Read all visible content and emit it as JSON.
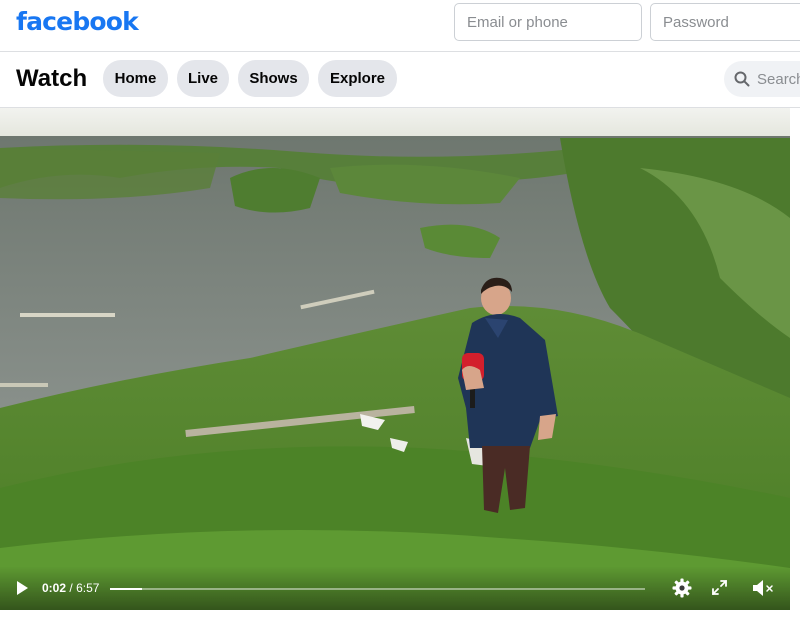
{
  "header": {
    "logo_text": "facebook",
    "logo_color": "#1877f2",
    "email_placeholder": "Email or phone",
    "password_placeholder": "Password"
  },
  "watch": {
    "title": "Watch",
    "tabs": [
      {
        "label": "Home"
      },
      {
        "label": "Live"
      },
      {
        "label": "Shows"
      },
      {
        "label": "Explore"
      }
    ],
    "search_placeholder": "Search"
  },
  "video": {
    "current_time": "0:02",
    "separator": "/",
    "duration": "6:57",
    "progress_fraction": 0.06,
    "controls": {
      "play_icon": "play-icon",
      "settings_icon": "gear-icon",
      "fullscreen_icon": "fullscreen-icon",
      "volume_icon": "volume-muted-icon"
    }
  }
}
